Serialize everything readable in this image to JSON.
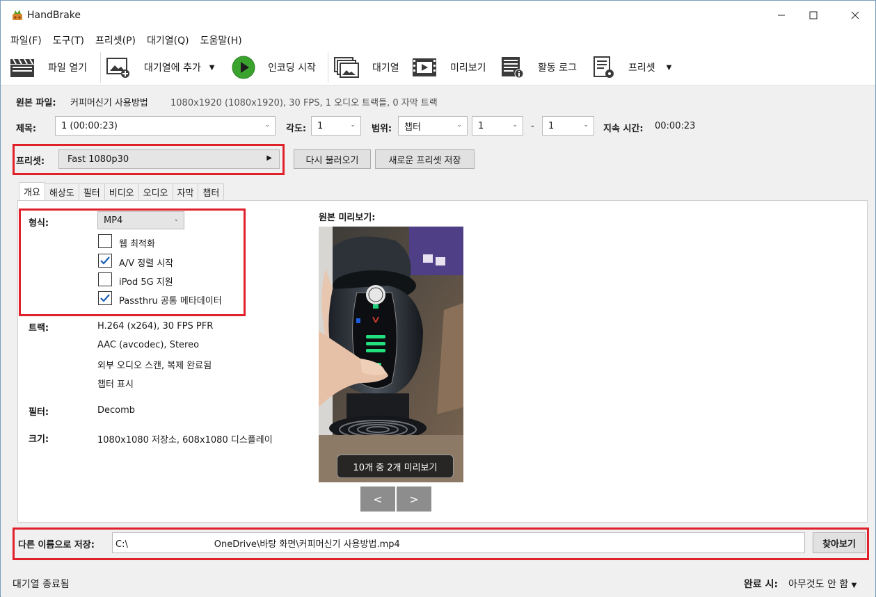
{
  "window": {
    "title": "HandBrake"
  },
  "menu": [
    "파일(F)",
    "도구(T)",
    "프리셋(P)",
    "대기열(Q)",
    "도움말(H)"
  ],
  "toolbar": {
    "open_file": "파일 열기",
    "add_queue": "대기열에 추가",
    "start_encode": "인코딩 시작",
    "queue": "대기열",
    "preview": "미리보기",
    "activity_log": "활동 로그",
    "presets": "프리셋"
  },
  "source": {
    "label": "원본 파일:",
    "name": "커피머신기 사용방법",
    "info": "1080x1920 (1080x1920), 30 FPS, 1 오디오 트랙들, 0 자막 트랙"
  },
  "title_row": {
    "title_label": "제목:",
    "title_value": "1  (00:00:23)",
    "angle_label": "각도:",
    "angle_value": "1",
    "range_label": "범위:",
    "range_type": "챕터",
    "range_start": "1",
    "range_dash": "-",
    "range_end": "1",
    "duration_label": "지속 시간:",
    "duration_value": "00:00:23"
  },
  "preset_row": {
    "label": "프리셋:",
    "value": "Fast 1080p30",
    "reload": "다시 불러오기",
    "save_new": "새로운 프리셋 저장"
  },
  "tabs": [
    "개요",
    "해상도",
    "필터",
    "비디오",
    "오디오",
    "자막",
    "챕터"
  ],
  "summary": {
    "format_label": "형식:",
    "format_value": "MP4",
    "web_optimize": "웹 최적화",
    "align_av": "A/V 정렬 시작",
    "ipod": "iPod 5G 지원",
    "passthru": "Passthru 공통 메타데이터",
    "tracks_label": "트랙:",
    "tracks": [
      "H.264 (x264), 30 FPS PFR",
      "AAC (avcodec), Stereo",
      "외부 오디오 스캔, 복제 완료됨",
      "챕터 표시"
    ],
    "filters_label": "필터:",
    "filters_value": "Decomb",
    "size_label": "크기:",
    "size_value": "1080x1080 저장소, 608x1080 디스플레이"
  },
  "preview": {
    "label": "원본 미리보기:",
    "caption": "10개 중 2개 미리보기",
    "prev": "<",
    "next": ">"
  },
  "save_as": {
    "label": "다른 이름으로 저장:",
    "path": "C:\\                              OneDrive\\바탕 화면\\커피머신기 사용방법.mp4",
    "browse": "찾아보기"
  },
  "status": {
    "left": "대기열 종료됨",
    "done_label": "완료 시:",
    "done_value": "아무것도 안 함"
  },
  "colors": {
    "highlight": "#e0202a",
    "check": "#1a5fb4"
  }
}
